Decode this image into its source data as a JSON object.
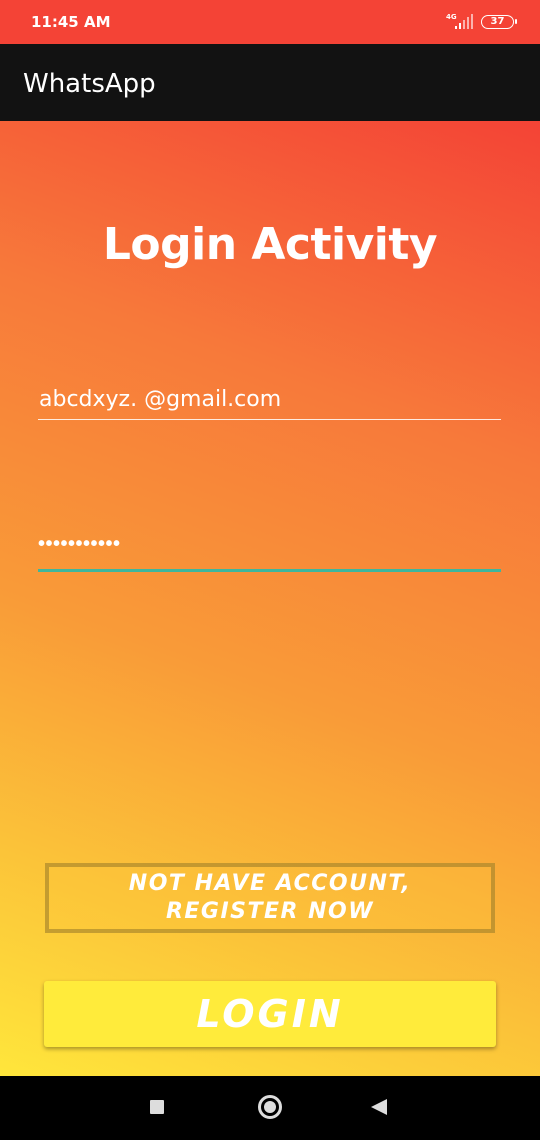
{
  "status_bar": {
    "time": "11:45 AM",
    "network": "4G",
    "battery": "37"
  },
  "app_bar": {
    "title": "WhatsApp"
  },
  "login": {
    "heading": "Login Activity",
    "email_value": "abcdxyz. @gmail.com",
    "password_value": "•••••••••••",
    "register_line1": "NOT HAVE ACCOUNT,",
    "register_line2": "REGISTER NOW",
    "login_label": "LOGIN"
  },
  "colors": {
    "status_bar": "#f44336",
    "app_bar": "#121212",
    "gradient_top": "#f44336",
    "gradient_bottom": "#ffe63b",
    "login_button": "#ffeb3b",
    "password_underline": "#3fb69c"
  },
  "nav_bar": {
    "icons": [
      "recents-icon",
      "home-icon",
      "back-icon"
    ]
  }
}
